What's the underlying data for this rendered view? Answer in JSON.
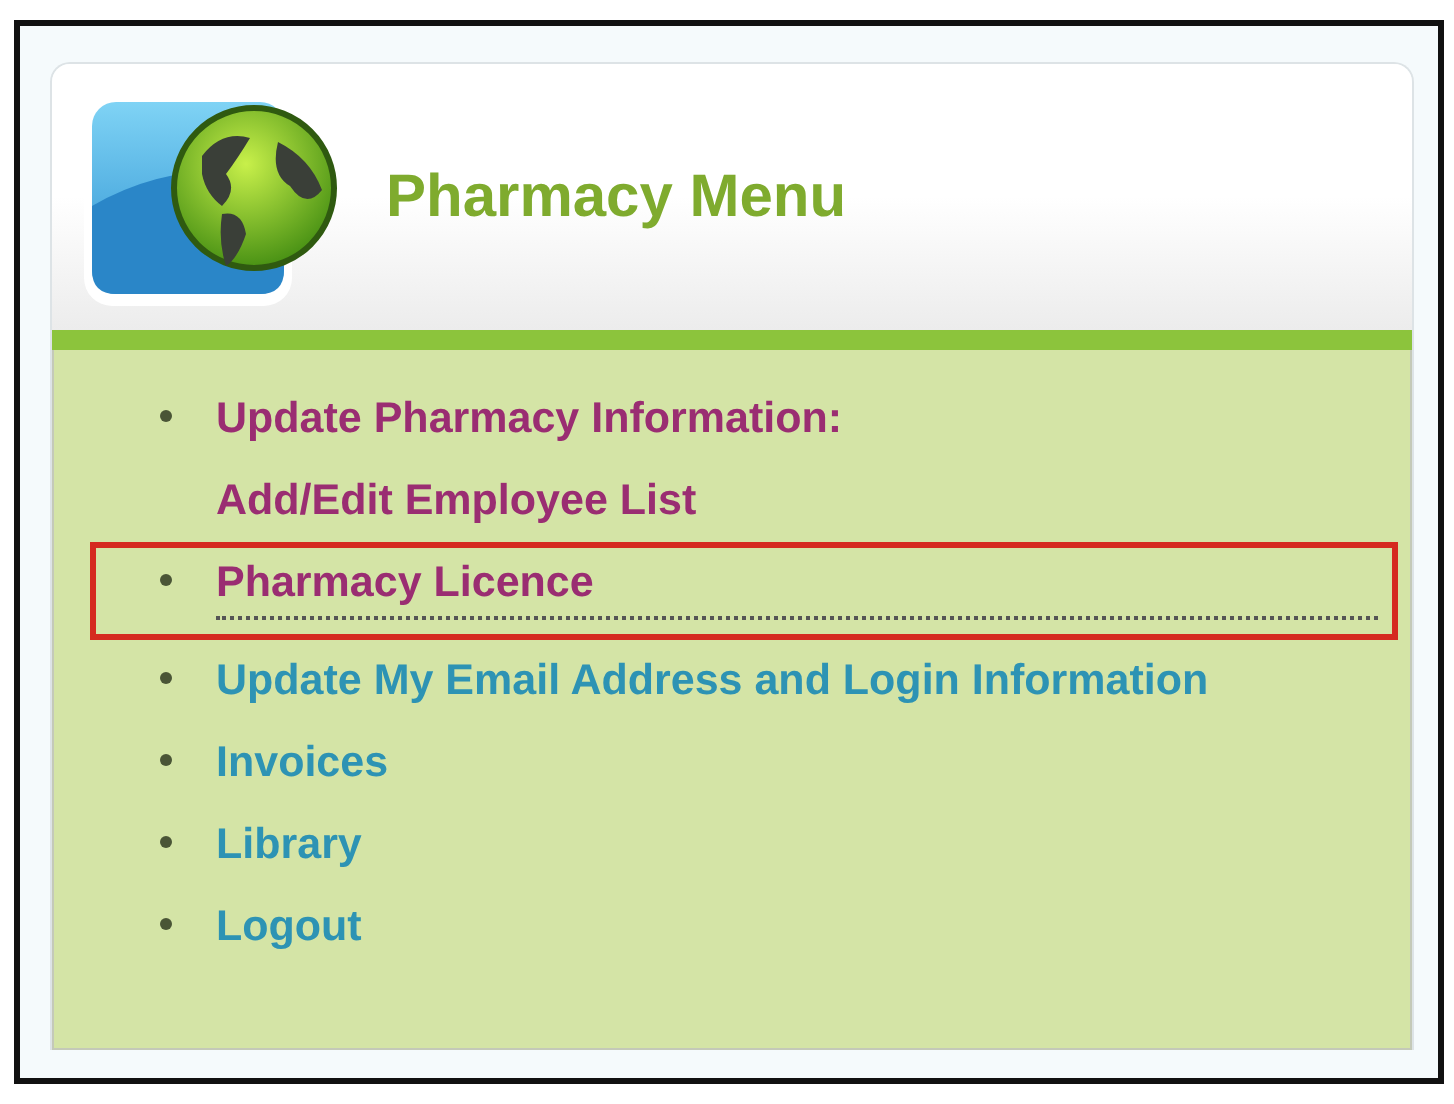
{
  "header": {
    "title": "Pharmacy Menu"
  },
  "menu": {
    "items": [
      {
        "lines": [
          "Update Pharmacy Information:",
          "Add/Edit Employee List"
        ],
        "visited": true,
        "highlighted": false
      },
      {
        "lines": [
          "Pharmacy Licence"
        ],
        "visited": true,
        "highlighted": true
      },
      {
        "lines": [
          "Update My Email Address and Login Information"
        ],
        "visited": false,
        "highlighted": false
      },
      {
        "lines": [
          "Invoices"
        ],
        "visited": false,
        "highlighted": false
      },
      {
        "lines": [
          "Library"
        ],
        "visited": false,
        "highlighted": false
      },
      {
        "lines": [
          "Logout"
        ],
        "visited": false,
        "highlighted": false
      }
    ]
  }
}
